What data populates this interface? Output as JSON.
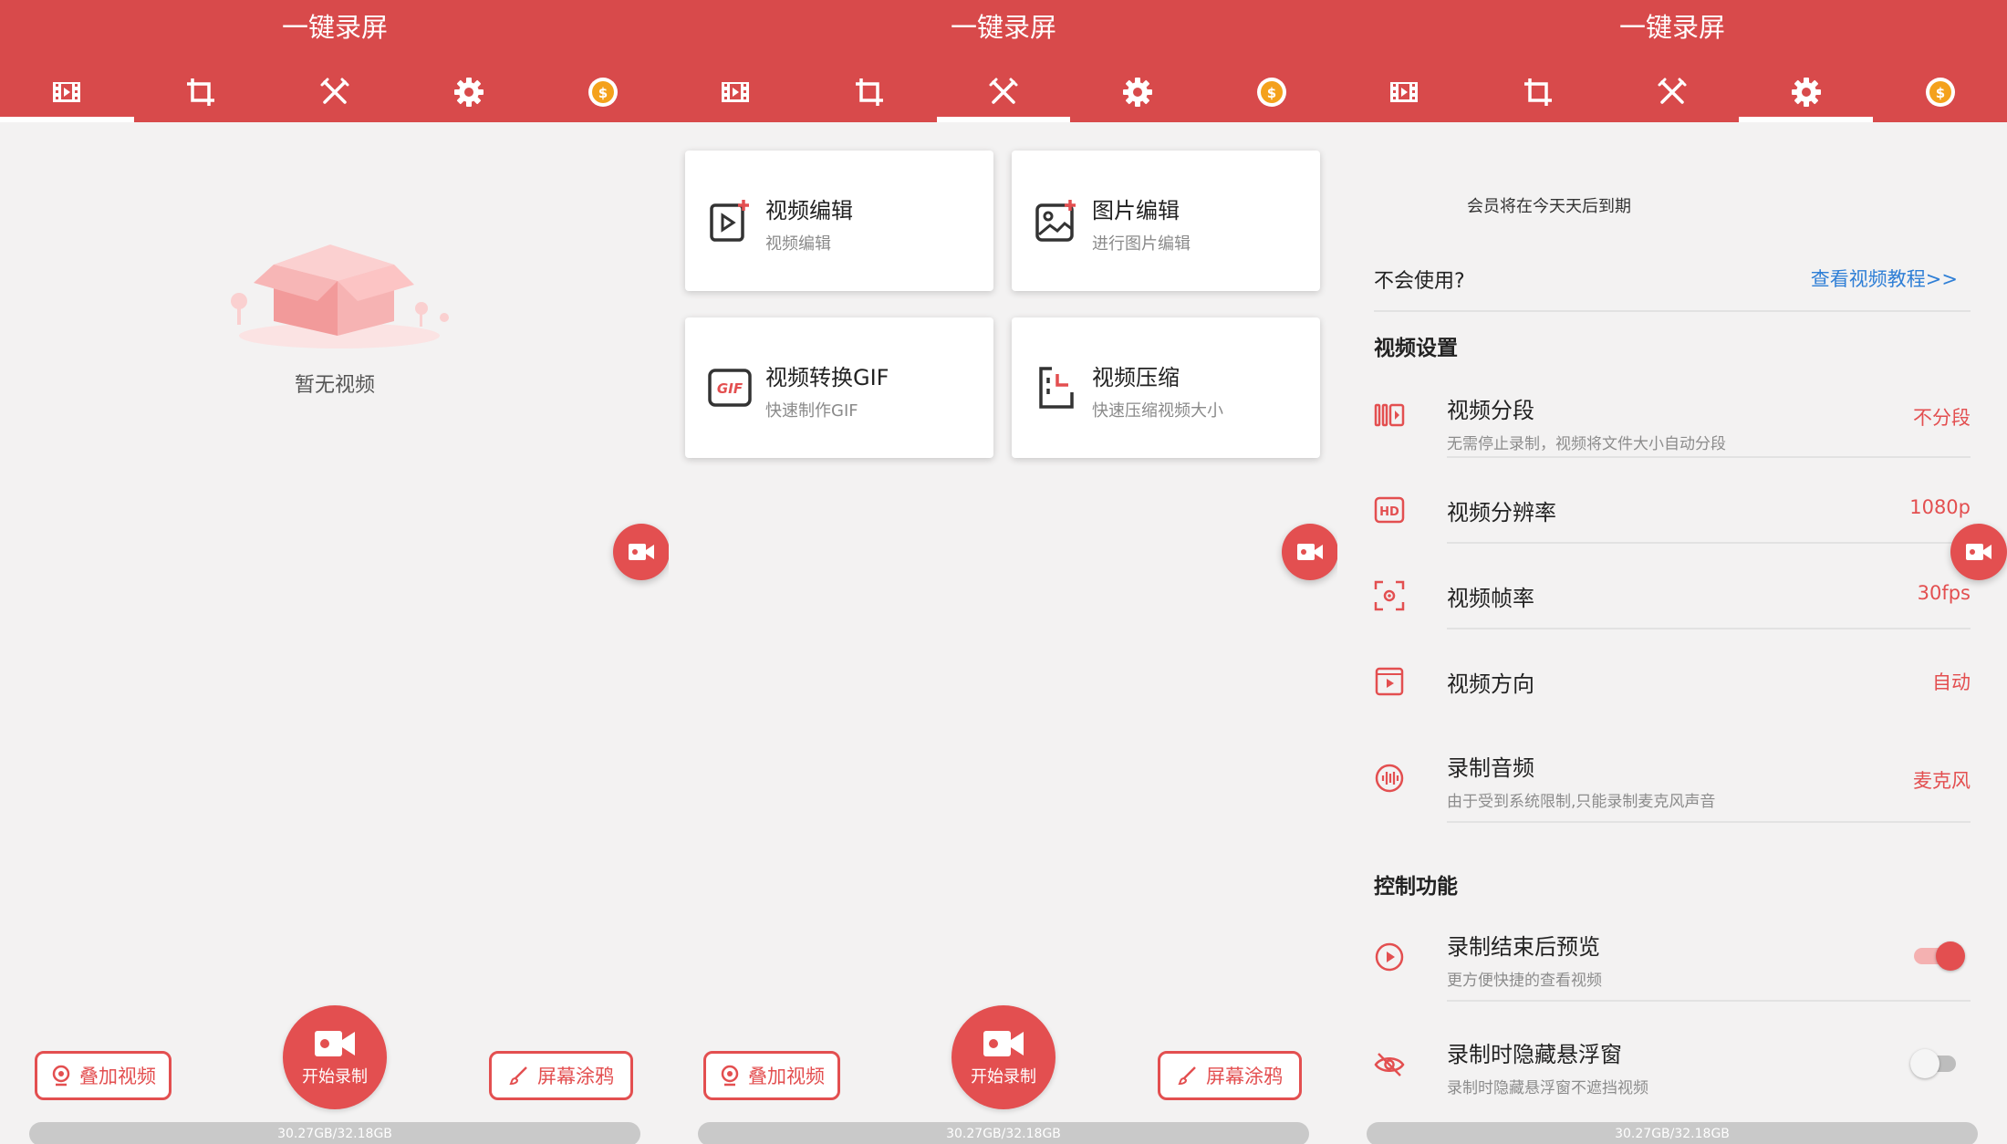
{
  "app": {
    "title": "一键录屏"
  },
  "tabs": [
    "video-tab",
    "crop-tab",
    "tools-tab",
    "settings-tab",
    "vip-tab"
  ],
  "colors": {
    "accent": "#d84a4b",
    "link": "#2f7fd6"
  },
  "home": {
    "empty_text": "暂无视频"
  },
  "bottom_bar": {
    "overlay_label": "叠加视频",
    "record_label": "开始录制",
    "doodle_label": "屏幕涂鸦",
    "storage": "30.27GB/32.18GB"
  },
  "tools": {
    "cards": [
      {
        "title": "视频编辑",
        "subtitle": "视频编辑",
        "icon": "video-edit-icon"
      },
      {
        "title": "图片编辑",
        "subtitle": "进行图片编辑",
        "icon": "image-edit-icon"
      },
      {
        "title": "视频转换GIF",
        "subtitle": "快速制作GIF",
        "icon": "gif-icon"
      },
      {
        "title": "视频压缩",
        "subtitle": "快速压缩视频大小",
        "icon": "compress-icon"
      }
    ]
  },
  "settings": {
    "member_text": "会员将在今天天后到期",
    "help_label": "不会使用?",
    "help_link": "查看视频教程>>",
    "video_section": "视频设置",
    "rows": [
      {
        "title": "视频分段",
        "subtitle": "无需停止录制，视频将文件大小自动分段",
        "value": "不分段"
      },
      {
        "title": "视频分辨率",
        "subtitle": "",
        "value": "1080p"
      },
      {
        "title": "视频帧率",
        "subtitle": "",
        "value": "30fps"
      },
      {
        "title": "视频方向",
        "subtitle": "",
        "value": "自动"
      },
      {
        "title": "录制音频",
        "subtitle": "由于受到系统限制,只能录制麦克风声音",
        "value": "麦克风"
      }
    ],
    "control_section": "控制功能",
    "controls": [
      {
        "title": "录制结束后预览",
        "subtitle": "更方便快捷的查看视频",
        "on": true
      },
      {
        "title": "录制时隐藏悬浮窗",
        "subtitle": "录制时隐藏悬浮窗不遮挡视频",
        "on": false
      }
    ]
  }
}
